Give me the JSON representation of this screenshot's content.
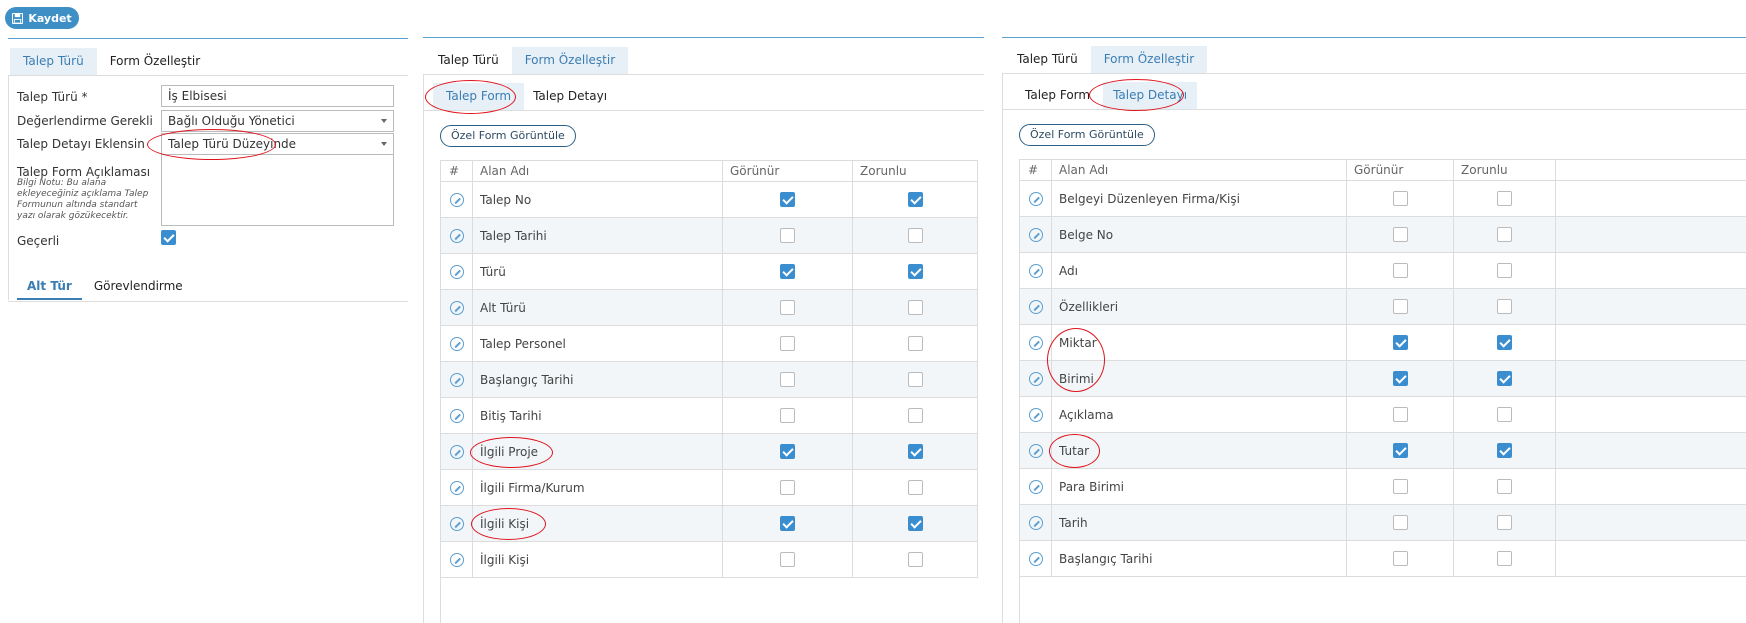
{
  "toolbar": {
    "save_label": "Kaydet"
  },
  "panel1": {
    "tabs": [
      "Talep Türü",
      "Form Özelleştir"
    ],
    "fields": {
      "talep_turu_label": "Talep Türü *",
      "talep_turu_value": "İş Elbisesi",
      "degerlendirme_label": "Değerlendirme Gerekli",
      "degerlendirme_value": "Bağlı Olduğu Yönetici",
      "detay_label": "Talep Detayı Eklensin",
      "detay_value": "Talep Türü Düzeyinde",
      "aciklama_label": "Talep Form Açıklaması",
      "aciklama_note": "Bilgi Notu: Bu alana ekleyeceğiniz açıklama Talep Formunun altında standart yazı olarak gözükecektir.",
      "gecerli_label": "Geçerli",
      "gecerli_checked": true
    },
    "bottom_tabs": [
      "Alt Tür",
      "Görevlendirme"
    ]
  },
  "panel2": {
    "tabs": [
      "Talep Türü",
      "Form Özelleştir"
    ],
    "subtabs": [
      "Talep Form",
      "Talep Detayı"
    ],
    "view_button": "Özel Form Görüntüle",
    "columns": [
      "#",
      "Alan Adı",
      "Görünür",
      "Zorunlu"
    ],
    "rows": [
      {
        "name": "Talep No",
        "visible": true,
        "required": true
      },
      {
        "name": "Talep Tarihi",
        "visible": false,
        "required": false
      },
      {
        "name": "Türü",
        "visible": true,
        "required": true
      },
      {
        "name": "Alt Türü",
        "visible": false,
        "required": false
      },
      {
        "name": "Talep Personel",
        "visible": false,
        "required": false
      },
      {
        "name": "Başlangıç Tarihi",
        "visible": false,
        "required": false
      },
      {
        "name": "Bitiş Tarihi",
        "visible": false,
        "required": false
      },
      {
        "name": "İlgili Proje",
        "visible": true,
        "required": true
      },
      {
        "name": "İlgili Firma/Kurum",
        "visible": false,
        "required": false
      },
      {
        "name": "İlgili Kişi",
        "visible": true,
        "required": true
      },
      {
        "name": "İlgili Kişi",
        "visible": false,
        "required": false
      }
    ]
  },
  "panel3": {
    "tabs": [
      "Talep Türü",
      "Form Özelleştir"
    ],
    "subtabs": [
      "Talep Form",
      "Talep Detayı"
    ],
    "view_button": "Özel Form Görüntüle",
    "columns": [
      "#",
      "Alan Adı",
      "Görünür",
      "Zorunlu"
    ],
    "rows": [
      {
        "name": "Belgeyi Düzenleyen Firma/Kişi",
        "visible": false,
        "required": false
      },
      {
        "name": "Belge No",
        "visible": false,
        "required": false
      },
      {
        "name": "Adı",
        "visible": false,
        "required": false
      },
      {
        "name": "Özellikleri",
        "visible": false,
        "required": false
      },
      {
        "name": "Miktar",
        "visible": true,
        "required": true
      },
      {
        "name": "Birimi",
        "visible": true,
        "required": true
      },
      {
        "name": "Açıklama",
        "visible": false,
        "required": false
      },
      {
        "name": "Tutar",
        "visible": true,
        "required": true
      },
      {
        "name": "Para Birimi",
        "visible": false,
        "required": false
      },
      {
        "name": "Tarih",
        "visible": false,
        "required": false
      },
      {
        "name": "Başlangıç Tarihi",
        "visible": false,
        "required": false
      }
    ]
  },
  "colors": {
    "accent": "#3f8fc7",
    "annotation": "#e0141e",
    "checked": "#3a8ed0"
  }
}
